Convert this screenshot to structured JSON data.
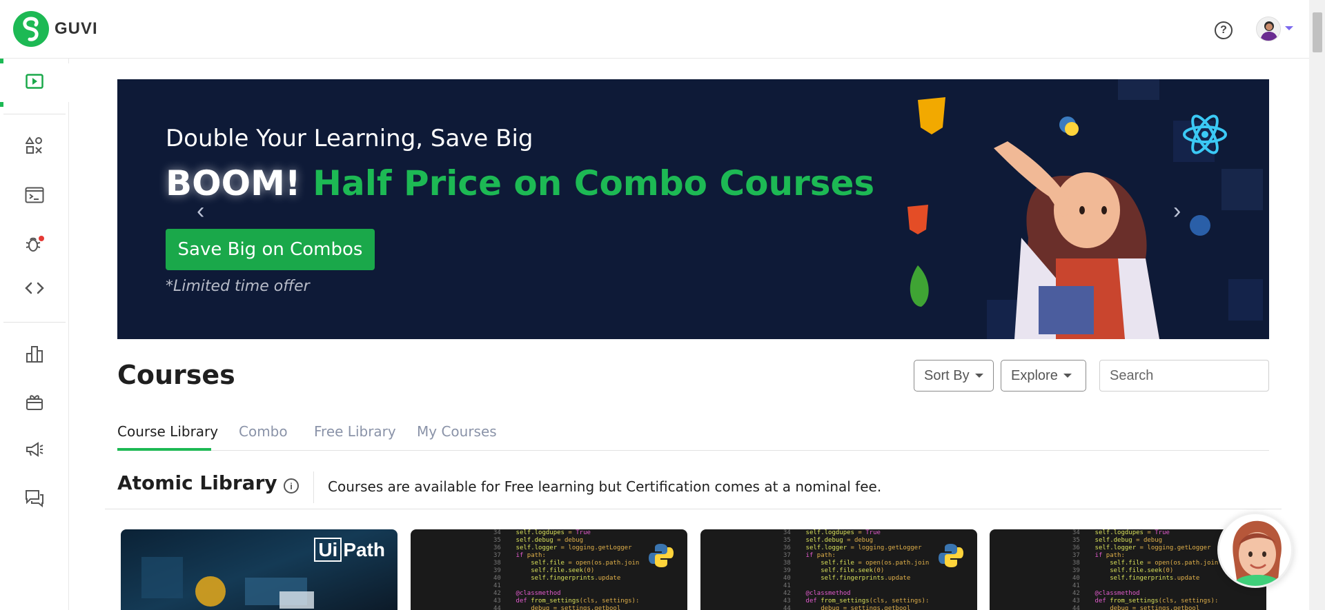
{
  "app": {
    "brand_name": "GUVI",
    "brand_color": "#1db954"
  },
  "header": {
    "help_icon": "help-circle-icon",
    "help_glyph": "?",
    "avatar_icon": "user-avatar"
  },
  "sidebar": {
    "items": [
      {
        "name": "video-play-icon",
        "active": true
      },
      {
        "name": "shapes-icon"
      },
      {
        "name": "terminal-icon"
      },
      {
        "name": "bug-icon",
        "badge": true
      },
      {
        "name": "code-icon"
      },
      {
        "name": "bar-chart-icon"
      },
      {
        "name": "gift-icon"
      },
      {
        "name": "megaphone-icon"
      },
      {
        "name": "chat-icon"
      }
    ]
  },
  "banner": {
    "subtitle": "Double Your Learning, Save Big",
    "title_boom": "BOOM!",
    "title_green": "Half Price on Combo Courses",
    "button_label": "Save Big on Combos",
    "note": "*Limited time offer",
    "prev_glyph": "‹",
    "next_glyph": "›",
    "bg_color": "#0e1a37"
  },
  "courses": {
    "title": "Courses",
    "sort_label": "Sort By",
    "explore_label": "Explore",
    "search_placeholder": "Search",
    "tabs": [
      {
        "label": "Course Library",
        "active": true
      },
      {
        "label": "Combo"
      },
      {
        "label": "Free Library"
      },
      {
        "label": "My Courses"
      }
    ]
  },
  "atomic": {
    "title": "Atomic Library",
    "info_glyph": "i",
    "description": "Courses are available for Free learning but Certification comes at a nominal fee."
  },
  "cards": [
    {
      "kind": "uipath",
      "logo_prefix": "Ui",
      "logo_suffix": "Path"
    },
    {
      "kind": "python"
    },
    {
      "kind": "python"
    },
    {
      "kind": "python"
    }
  ]
}
